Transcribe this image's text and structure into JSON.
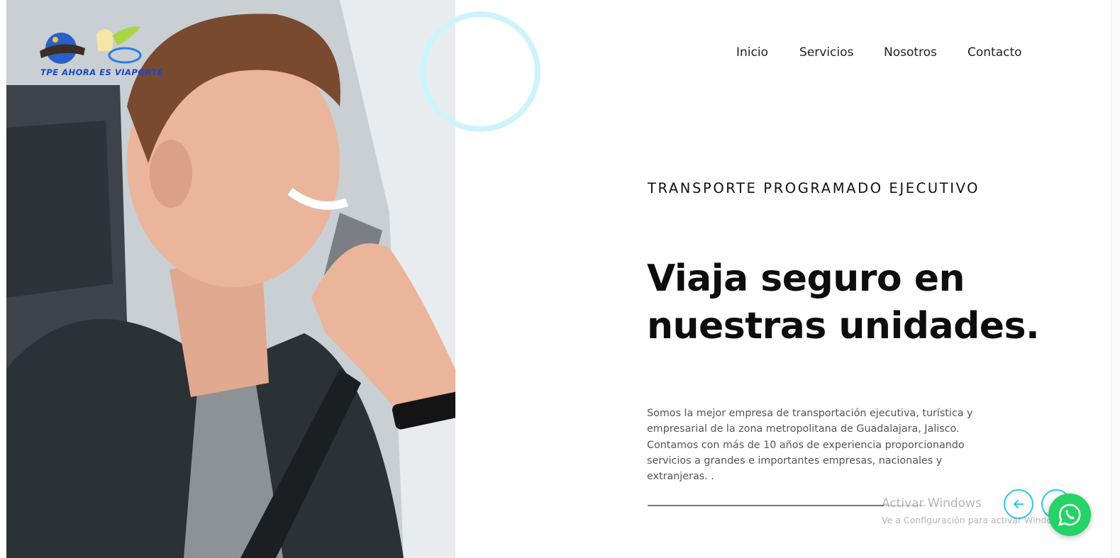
{
  "brand": {
    "logo_caption": "TPE AHORA ES VIAPORTE"
  },
  "nav": {
    "items": [
      {
        "label": "Inicio"
      },
      {
        "label": "Servicios"
      },
      {
        "label": "Nosotros"
      },
      {
        "label": "Contacto"
      }
    ]
  },
  "hero": {
    "eyebrow": "TRANSPORTE PROGRAMADO EJECUTIVO",
    "headline_line1": "Viaja seguro en",
    "headline_line2": "nuestras unidades.",
    "body": "Somos la mejor empresa de transportación ejecutiva, turística y empresarial de la zona metropolitana de Guadalajara, Jalisco. Contamos con más de 10 años de experiencia proporcionando servicios a grandes e importantes empresas, nacionales y extranjeras. .",
    "slider_progress": 0.85
  },
  "controls": {
    "prev_icon": "arrow-left-icon",
    "next_icon": "arrow-right-icon"
  },
  "windows_watermark": {
    "title": "Activar Windows",
    "subtitle": "Ve a Configuración para activar Windows."
  },
  "floating": {
    "icon": "whatsapp-icon"
  },
  "colors": {
    "accent": "#29c7e8",
    "ring": "#cdf4fb",
    "whatsapp": "#25d366",
    "logo_text": "#1a47c9"
  }
}
